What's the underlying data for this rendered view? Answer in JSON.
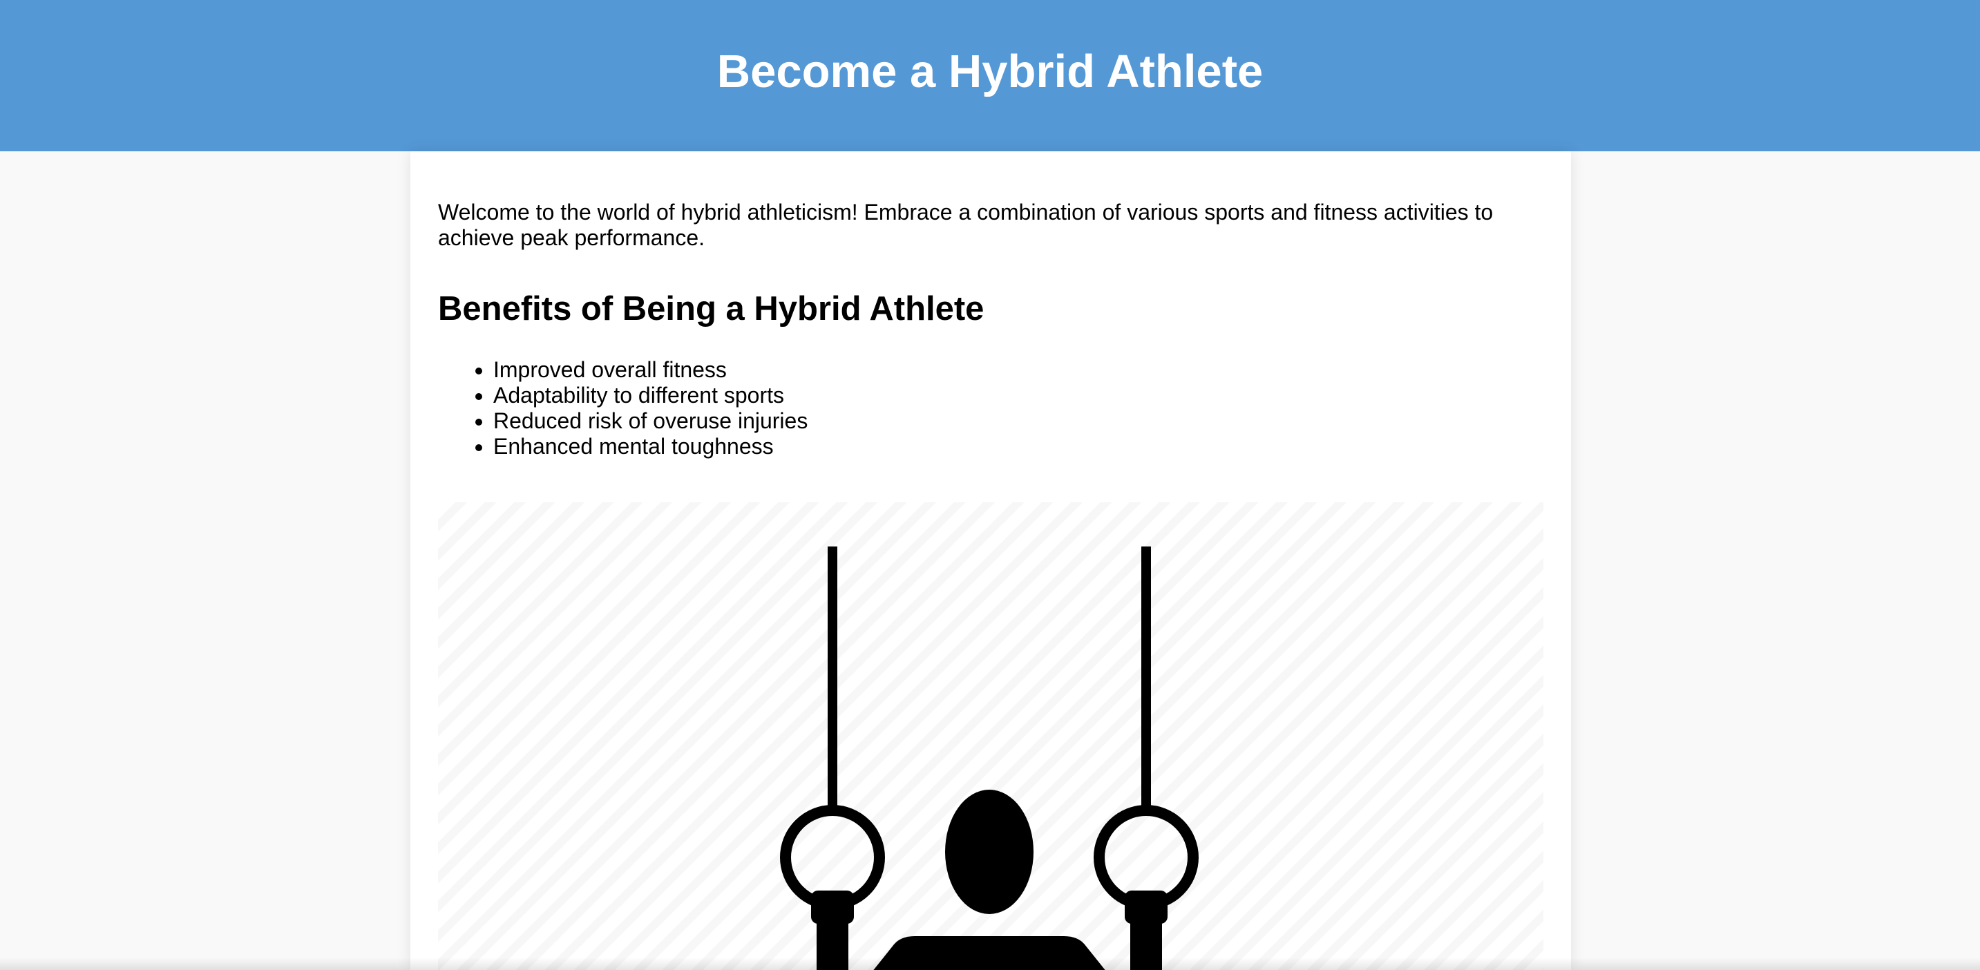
{
  "header": {
    "title": "Become a Hybrid Athlete",
    "background": "#5498d6"
  },
  "main": {
    "intro": "Welcome to the world of hybrid athleticism! Embrace a combination of various sports and fitness activities to achieve peak performance.",
    "benefits": {
      "title": "Benefits of Being a Hybrid Athlete",
      "items": [
        "Improved overall fitness",
        "Adaptability to different sports",
        "Reduced risk of overuse injuries",
        "Enhanced mental toughness"
      ]
    },
    "image": {
      "icon": "gymnastics-rings-athlete-icon"
    }
  }
}
